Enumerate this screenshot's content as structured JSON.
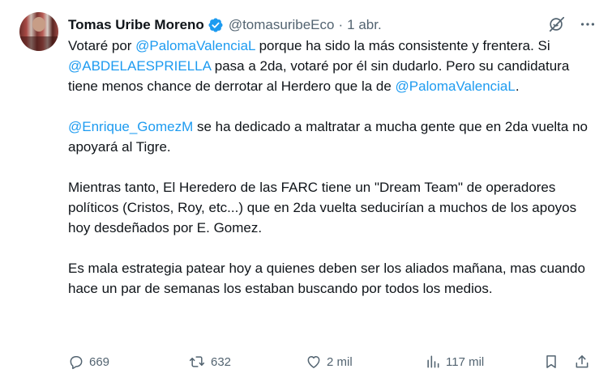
{
  "author": {
    "name": "Tomas Uribe Moreno",
    "handle": "@tomasuribeEco",
    "separator": "·",
    "time": "1 abr."
  },
  "body": {
    "p1": {
      "t1": "Votaré por ",
      "m1": "@PalomaValenciaL",
      "t2": " porque ha sido la más consistente y frentera. Si ",
      "m2": "@ABDELAESPRIELLA",
      "t3": " pasa a 2da, votaré por él sin dudarlo. Pero su candidatura tiene menos chance de derrotar al Herdero que la de ",
      "m3": "@PalomaValenciaL",
      "t4": "."
    },
    "p2": {
      "m1": "@Enrique_GomezM",
      "t1": " se ha dedicado a maltratar a mucha gente que en 2da vuelta no apoyará  al Tigre."
    },
    "p3": "Mientras tanto, El Heredero de las FARC tiene un \"Dream Team\" de operadores políticos (Cristos, Roy, etc...) que en 2da vuelta seducirían a muchos de los apoyos hoy desdeñados por E. Gomez.",
    "p4": "Es mala estrategia patear hoy a quienes deben ser los aliados mañana, mas cuando hace un par de semanas los estaban buscando por todos los medios."
  },
  "metrics": {
    "replies": "669",
    "reposts": "632",
    "likes": "2 mil",
    "views": "117 mil"
  },
  "icons": {
    "verified": "verified-badge-icon",
    "grok": "grok-icon",
    "more": "more-icon",
    "reply": "reply-icon",
    "repost": "repost-icon",
    "like": "heart-icon",
    "views": "views-icon",
    "bookmark": "bookmark-icon",
    "share": "share-icon"
  },
  "colors": {
    "accent": "#1d9bf0",
    "text": "#0f1419",
    "muted": "#536471"
  }
}
